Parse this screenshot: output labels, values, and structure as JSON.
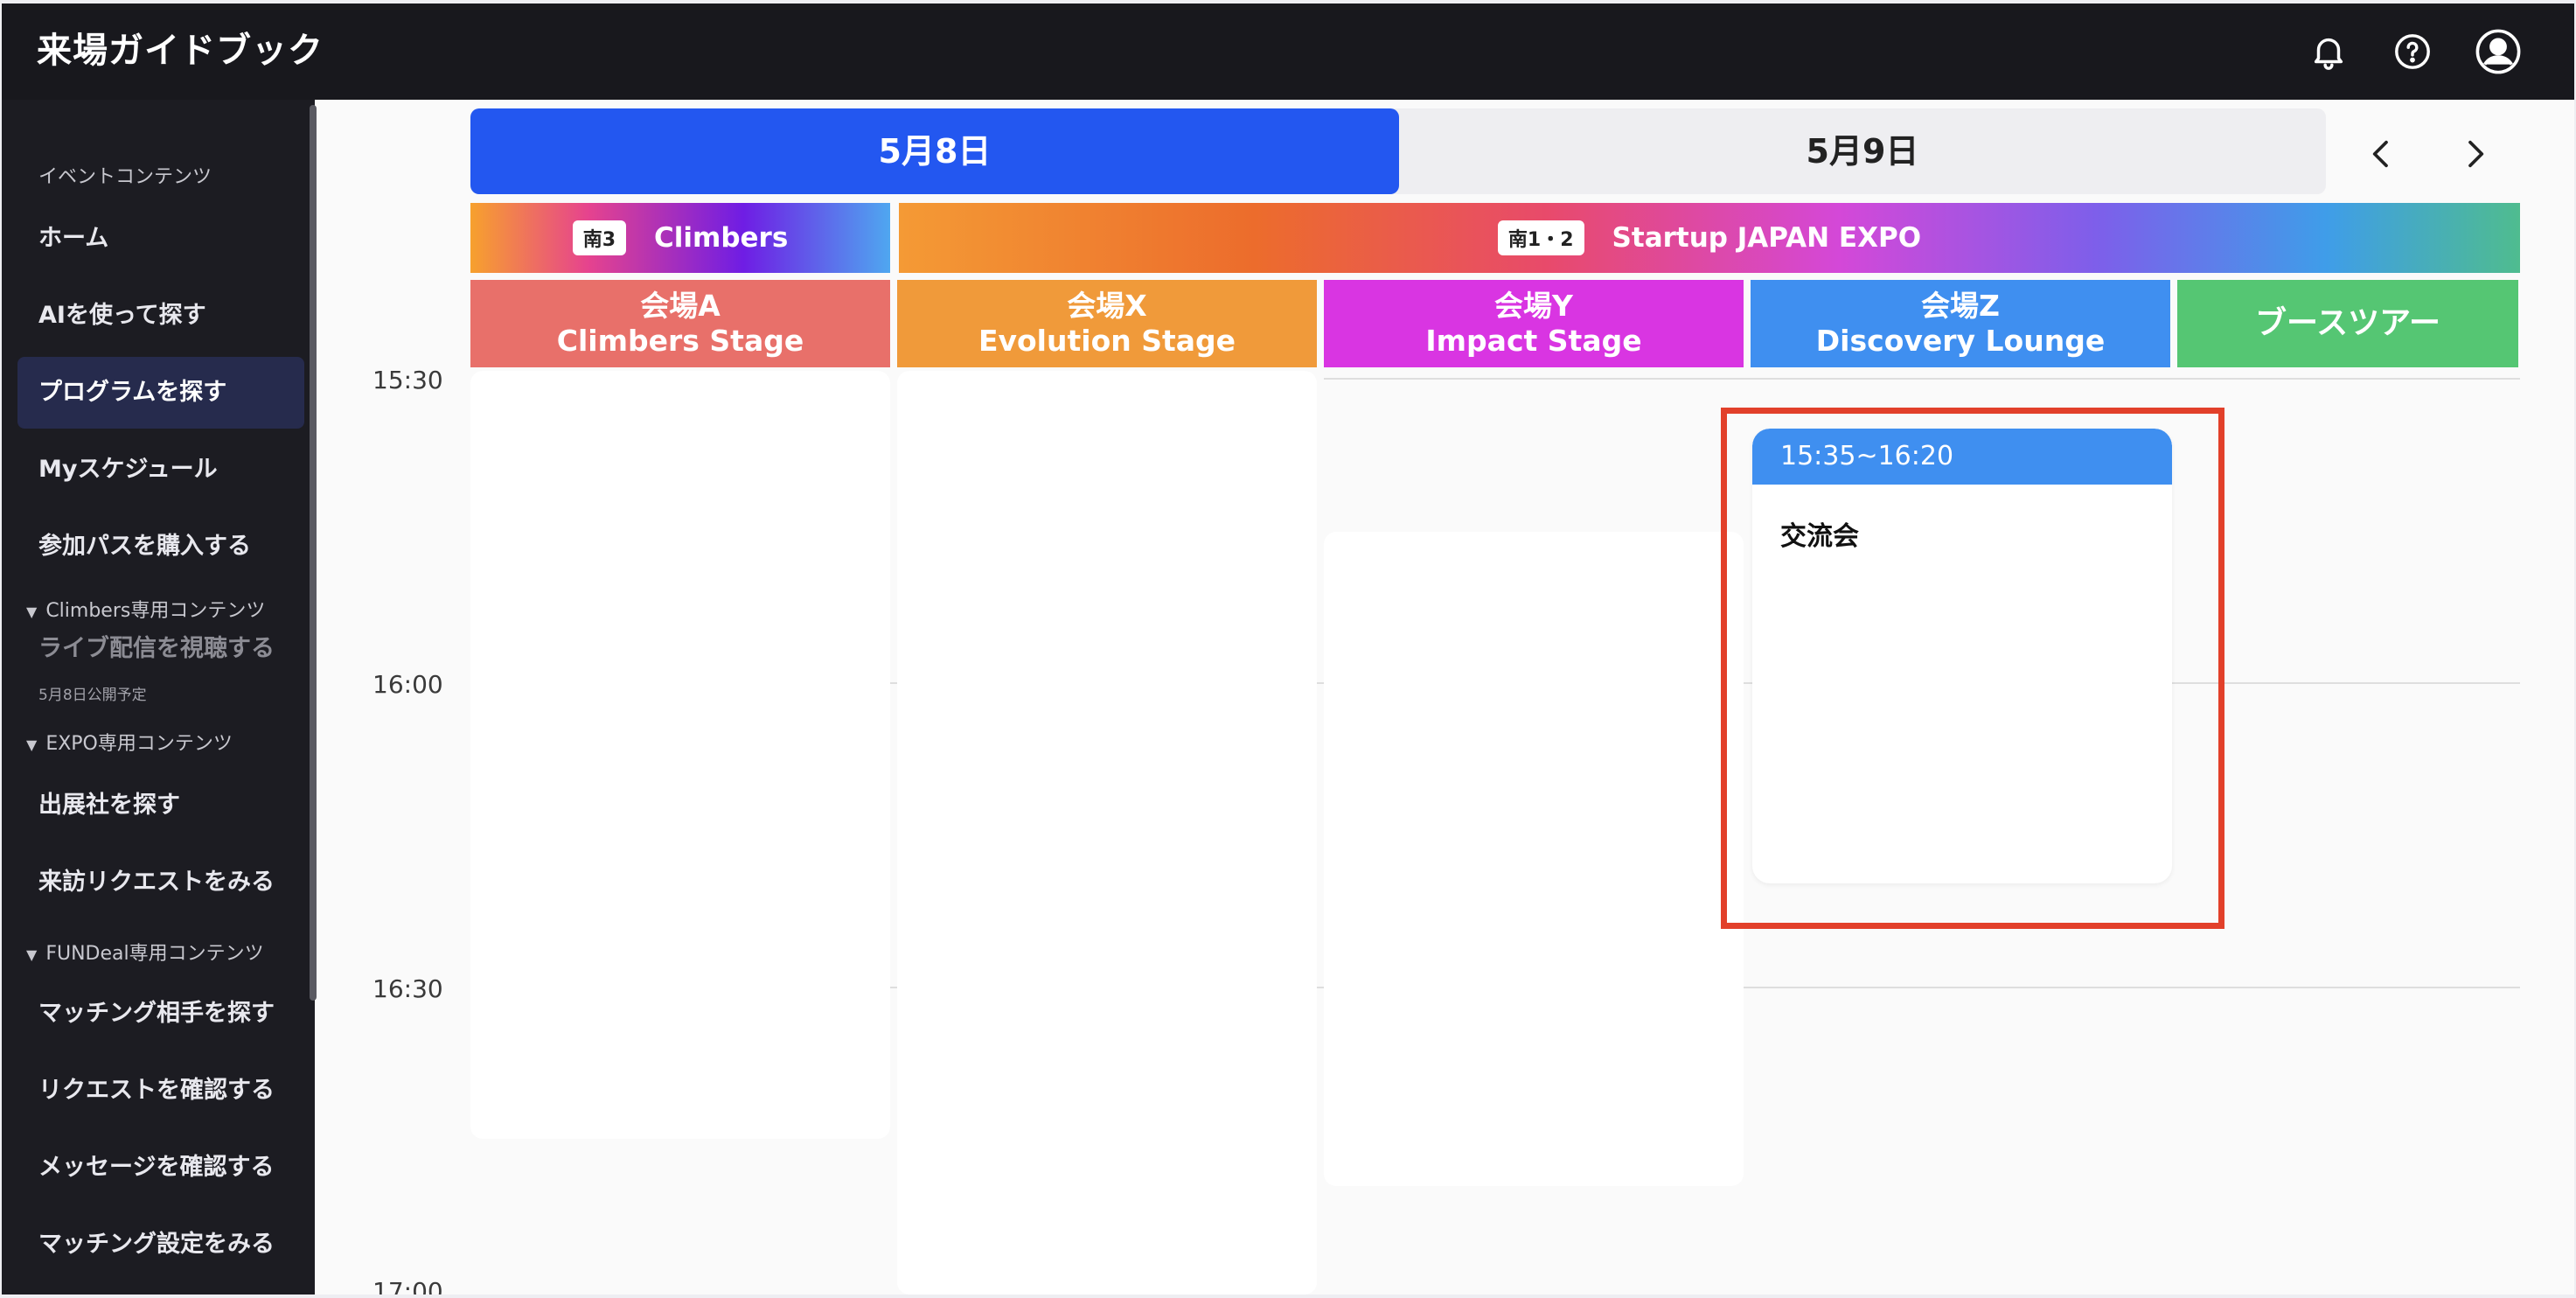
{
  "app": {
    "title": "来場ガイドブック"
  },
  "sidebar": {
    "section_event": "イベントコンテンツ",
    "items": [
      {
        "label": "ホーム"
      },
      {
        "label": "AIを使って探す"
      },
      {
        "label": "プログラムを探す"
      },
      {
        "label": "Myスケジュール"
      },
      {
        "label": "参加パスを購入する"
      }
    ],
    "group_climbers": "Climbers専用コンテンツ",
    "live": {
      "label": "ライブ配信を視聴する",
      "sub": "5月8日公開予定"
    },
    "group_expo": "EXPO専用コンテンツ",
    "expo_items": [
      {
        "label": "出展社を探す"
      },
      {
        "label": "来訪リクエストをみる"
      }
    ],
    "group_fundeal": "FUNDeal専用コンテンツ",
    "fundeal_items": [
      {
        "label": "マッチング相手を探す"
      },
      {
        "label": "リクエストを確認する"
      },
      {
        "label": "メッセージを確認する"
      },
      {
        "label": "マッチング設定をみる"
      }
    ]
  },
  "dates": {
    "tab1": "5月8日",
    "tab2": "5月9日",
    "selected": "5月8日"
  },
  "banners": {
    "climbers": {
      "hall": "南3",
      "name": "Climbers"
    },
    "expo": {
      "hall": "南1・2",
      "name": "Startup JAPAN EXPO"
    }
  },
  "stages": [
    {
      "venue": "会場A",
      "name": "Climbers Stage"
    },
    {
      "venue": "会場X",
      "name": "Evolution Stage"
    },
    {
      "venue": "会場Y",
      "name": "Impact Stage"
    },
    {
      "venue": "会場Z",
      "name": "Discovery Lounge"
    },
    {
      "venue": "",
      "name": "ブースツアー"
    }
  ],
  "times": [
    "15:30",
    "16:00",
    "16:30",
    "17:00"
  ],
  "event": {
    "time": "15:35~16:20",
    "title": "交流会"
  },
  "colors": {
    "header_bg": "#18181d",
    "accent_blue": "#2357f0",
    "highlight_red": "#e2402a"
  },
  "icons": {
    "bell": "bell-icon",
    "help": "help-icon",
    "account": "account-icon",
    "prev": "chevron-left-icon",
    "next": "chevron-right-icon",
    "chatbot": "chatbot-icon"
  }
}
